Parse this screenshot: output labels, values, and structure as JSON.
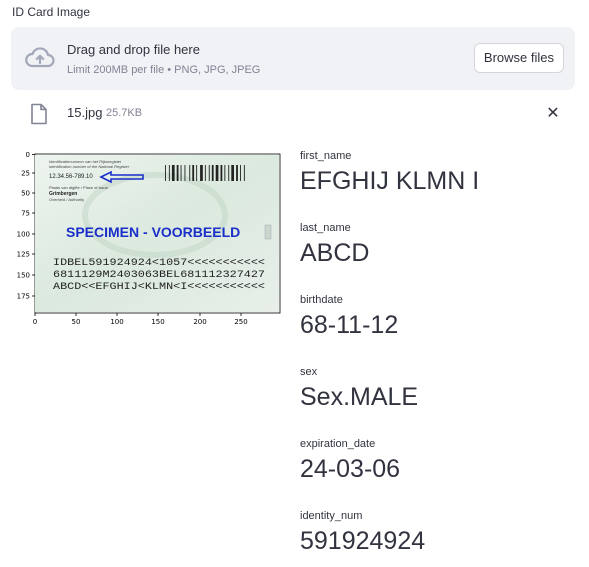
{
  "uploader": {
    "label": "ID Card Image",
    "drop_title": "Drag and drop file here",
    "limit_text": "Limit 200MB per file • PNG, JPG, JPEG",
    "browse_label": "Browse files"
  },
  "file": {
    "name": "15.jpg",
    "size": "25.7KB",
    "close_glyph": "✕"
  },
  "card_image": {
    "header_line1": "Identificatienummer van het Rijksregister",
    "header_line2": "Identification number of the National Register",
    "id_number": "12.34.56-789.10",
    "place_label": "Plaats van afgifte / Place of issue",
    "place": "Grimbergen",
    "authority": "Overheid / Authority",
    "specimen": "SPECIMEN - VOORBEELD",
    "mrz_line1": "IDBEL591924924<1057<<<<<<<<<<<",
    "mrz_line2": "6811129M2403063BEL681112327427",
    "mrz_line3": "ABCD<<EFGHIJ<KLMN<I<<<<<<<<<<<",
    "x_ticks": [
      "0",
      "50",
      "100",
      "150",
      "200",
      "250"
    ],
    "y_ticks": [
      "0",
      "25",
      "50",
      "75",
      "100",
      "125",
      "150",
      "175"
    ]
  },
  "fields": [
    {
      "label": "first_name",
      "value": "EFGHIJ KLMN I"
    },
    {
      "label": "last_name",
      "value": "ABCD"
    },
    {
      "label": "birthdate",
      "value": "68-11-12"
    },
    {
      "label": "sex",
      "value": "Sex.MALE"
    },
    {
      "label": "expiration_date",
      "value": "24-03-06"
    },
    {
      "label": "identity_num",
      "value": "591924924"
    }
  ],
  "colors": {
    "dropzone_bg": "#f0f2f6",
    "text": "#31333f",
    "muted": "#808495",
    "specimen_blue": "#1a2fc9",
    "card_green": "#d9e8dc"
  }
}
